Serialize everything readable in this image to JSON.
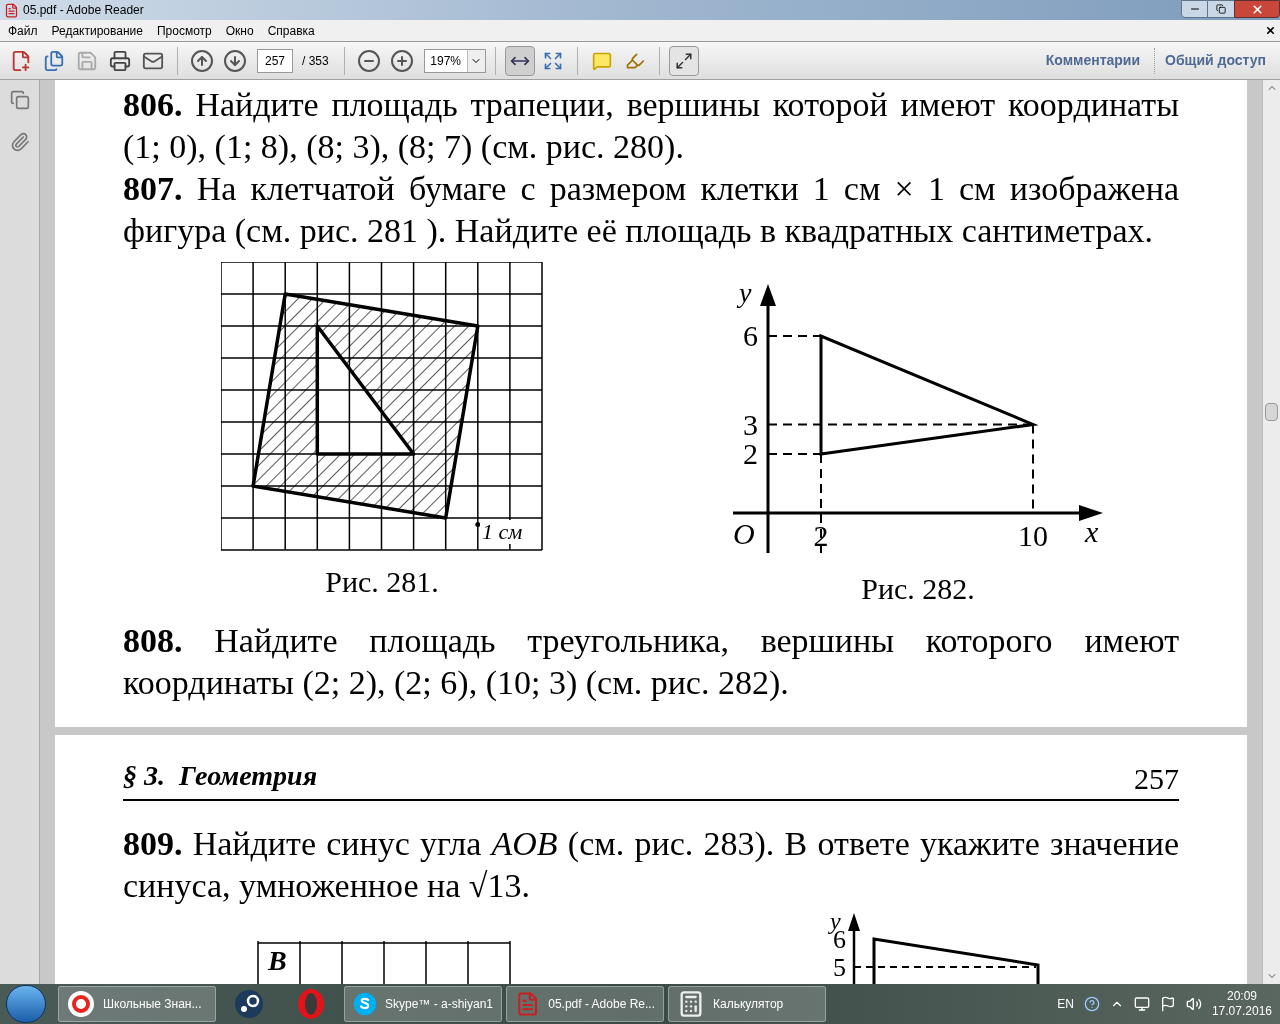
{
  "window": {
    "title": "05.pdf - Adobe Reader"
  },
  "menu": [
    "Файл",
    "Редактирование",
    "Просмотр",
    "Окно",
    "Справка"
  ],
  "toolbar": {
    "page": "257",
    "page_total": "/ 353",
    "zoom": "197%",
    "links": [
      "Комментарии",
      "Общий доступ"
    ]
  },
  "page1": {
    "problems_before": [
      "**806.** Найдите площадь трапеции, вершины которой имеют координаты (1; 0), (1; 8), (8; 3), (8; 7) (см. рис. 280).",
      "**807.** На клетчатой бумаге с размером клетки 1 см × 1 см изображена фигура (см. рис. 281 ). Найдите её площадь в квадратных сантиметрах."
    ],
    "figures": [
      {
        "kind": "grid",
        "scale_label": "1 см",
        "caption": "Рис. 281."
      },
      {
        "kind": "axes",
        "y_label": "y",
        "x_label": "x",
        "origin": "O",
        "y_ticks": [
          "6",
          "3",
          "2"
        ],
        "x_ticks": [
          "2",
          "10"
        ],
        "caption": "Рис. 282."
      }
    ],
    "problems_after": [
      "**808.** Найдите площадь треугольника, вершины которого имеют координаты (2; 2), (2; 6), (10; 3) (см. рис. 282)."
    ]
  },
  "page2": {
    "section": "§ 3.  Геометрия",
    "page_number": "257",
    "problems": [
      "**809.** Найдите синус угла *AOB* (см. рис. 283). В ответе укажите значение синуса, умноженное на √13."
    ],
    "figures": [
      {
        "kind": "grid_partial",
        "corner_label": "B"
      },
      {
        "kind": "axes_partial",
        "y_label": "y",
        "y_ticks": [
          "6",
          "5"
        ]
      }
    ]
  },
  "taskbar": {
    "items": [
      {
        "kind": "browser",
        "label": "Школьные Знан..."
      },
      {
        "kind": "steam"
      },
      {
        "kind": "opera"
      },
      {
        "kind": "skype",
        "label": "Skype™ - a-shiyan1"
      },
      {
        "kind": "pdf",
        "label": "05.pdf - Adobe Re..."
      },
      {
        "kind": "calculator",
        "label": "Калькулятор"
      }
    ],
    "language": "EN",
    "time": "20:09",
    "date": "17.07.2016"
  }
}
